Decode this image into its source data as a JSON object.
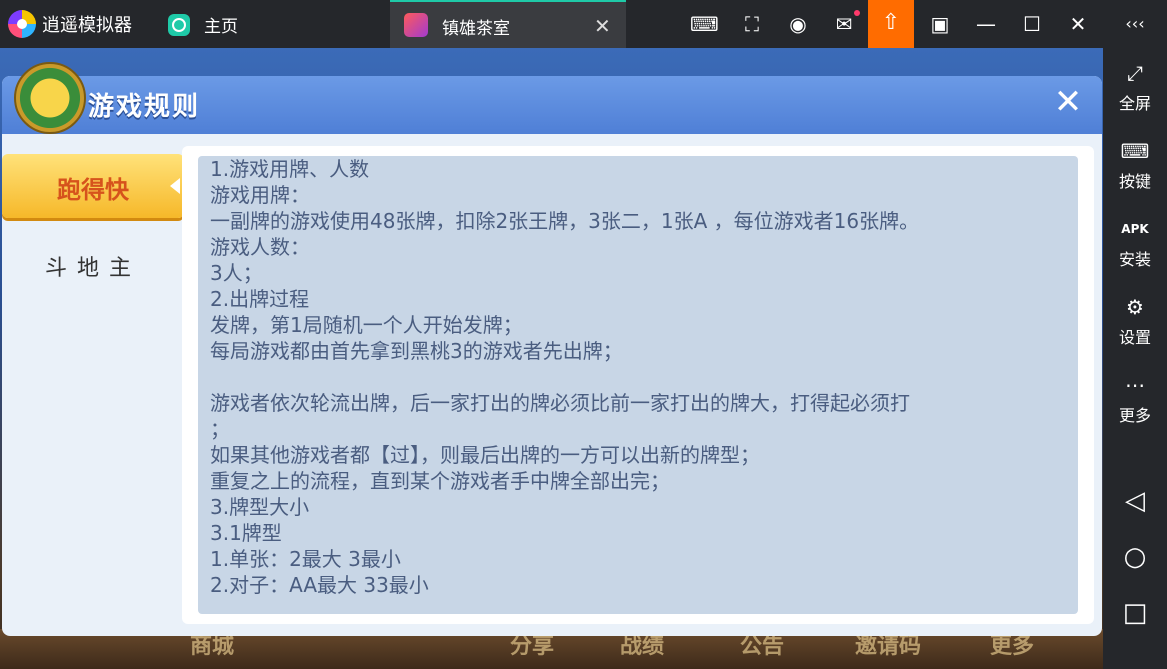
{
  "emulator": {
    "brand": "逍遥模拟器",
    "home_tab": "主页",
    "active_tab": "镇雄茶室",
    "sidebar": [
      {
        "label": "全屏",
        "icon": "fullscreen-icon"
      },
      {
        "label": "按键",
        "icon": "keyboard-icon"
      },
      {
        "label": "安装",
        "icon": "apk-icon"
      },
      {
        "label": "设置",
        "icon": "gear-icon"
      },
      {
        "label": "更多",
        "icon": "more-icon"
      }
    ]
  },
  "game": {
    "bottom_menu": [
      "商城",
      "分享",
      "战绩",
      "公告",
      "邀请码",
      "更多"
    ]
  },
  "dialog": {
    "title": "游戏规则",
    "tabs": [
      "跑得快",
      "斗地主"
    ],
    "rules": [
      "1.游戏用牌、人数",
      "游戏用牌：",
      "一副牌的游戏使用48张牌，扣除2张王牌，3张二，1张A ，每位游戏者16张牌。",
      "游戏人数：",
      "3人；",
      "2.出牌过程",
      "发牌，第1局随机一个人开始发牌；",
      "每局游戏都由首先拿到黑桃3的游戏者先出牌；",
      "",
      "游戏者依次轮流出牌，后一家打出的牌必须比前一家打出的牌大，打得起必须打",
      "；",
      "如果其他游戏者都【过】，则最后出牌的一方可以出新的牌型；",
      "重复之上的流程，直到某个游戏者手中牌全部出完；",
      "3.牌型大小",
      "3.1牌型",
      "1.单张：2最大   3最小",
      "2.对子：AA最大   33最小"
    ]
  }
}
